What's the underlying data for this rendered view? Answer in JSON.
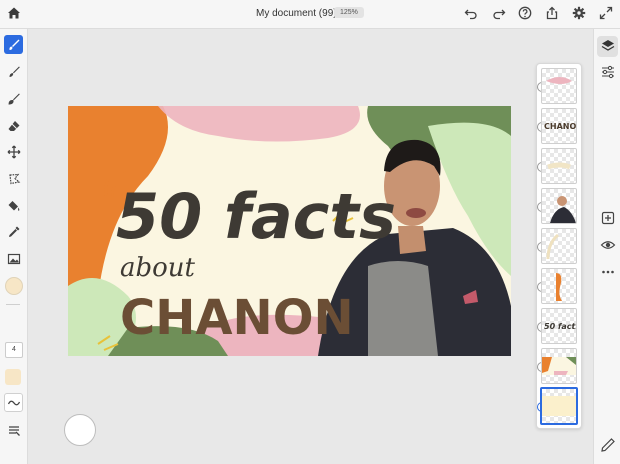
{
  "header": {
    "document_title": "My document (99)",
    "zoom_level": "125%"
  },
  "tools": {
    "brush_size": "4"
  },
  "artwork": {
    "line1": "50 facts",
    "line2": "about",
    "line3": "CHANON"
  },
  "layers": {
    "thumb_texts": [
      "",
      "CHANON",
      "",
      "",
      "",
      "",
      "50 facts",
      "",
      ""
    ]
  },
  "colors": {
    "accent": "#2c6be0",
    "orange": "#e9812f",
    "pink": "#edb5bf",
    "green": "#6f8f58",
    "lightgreen": "#cde8b9",
    "brown": "#4a3a2b",
    "cream": "#fbf6e1"
  }
}
